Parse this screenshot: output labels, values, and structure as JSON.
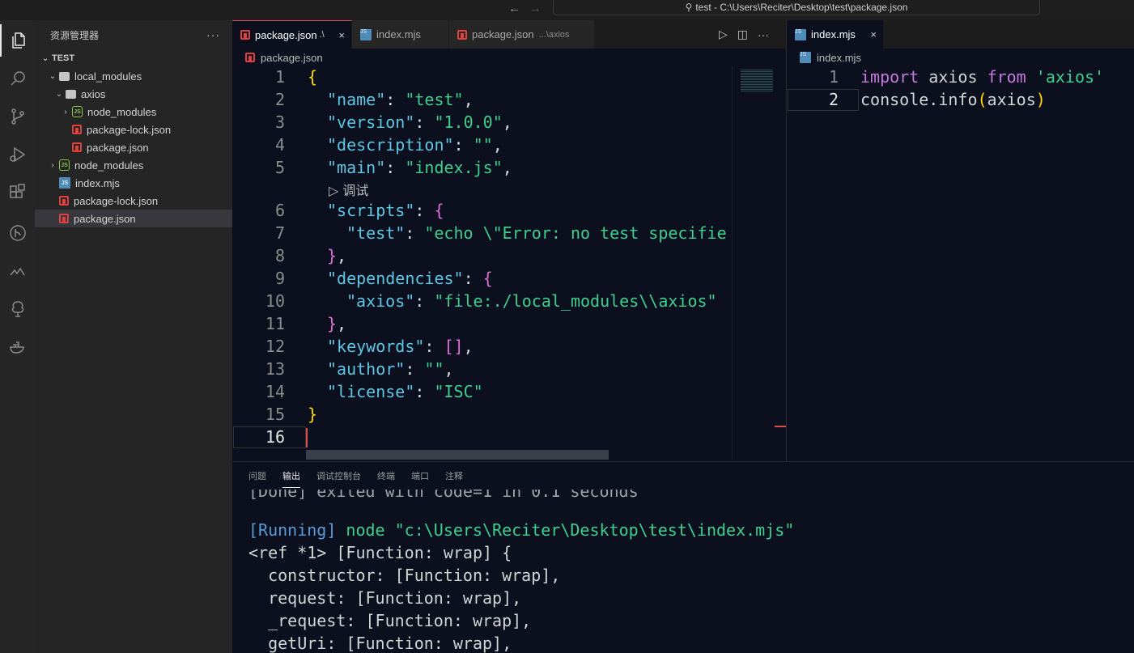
{
  "window": {
    "title": "test - C:\\Users\\Reciter\\Desktop\\test\\package.json"
  },
  "colors": {
    "background": "#0b0f1e",
    "tab_active_border": "#e04b4b",
    "json_key": "#5ec7e3",
    "json_string": "#3ecf8e",
    "keyword": "#c678dd"
  },
  "activity_bar": {
    "items": [
      "files-icon",
      "search-icon",
      "source-control-icon",
      "run-debug-icon",
      "extensions-icon",
      "git-graph-icon",
      "remote-icon",
      "tree-icon",
      "docker-icon"
    ]
  },
  "explorer": {
    "title": "资源管理器",
    "more": "···",
    "root": "TEST",
    "items": [
      {
        "label": "local_modules",
        "type": "folder",
        "open": true
      },
      {
        "label": "axios",
        "type": "folder",
        "open": true
      },
      {
        "label": "node_modules",
        "type": "node-folder",
        "open": false
      },
      {
        "label": "package-lock.json",
        "type": "json"
      },
      {
        "label": "package.json",
        "type": "json"
      },
      {
        "label": "node_modules",
        "type": "node-folder",
        "open": false
      },
      {
        "label": "index.mjs",
        "type": "js"
      },
      {
        "label": "package-lock.json",
        "type": "json"
      },
      {
        "label": "package.json",
        "type": "json",
        "selected": true
      }
    ]
  },
  "editor_left": {
    "tabs": [
      {
        "label": "package.json",
        "desc": ".\\",
        "close": "×"
      },
      {
        "label": "index.mjs",
        "desc": ""
      },
      {
        "label": "package.json",
        "desc": "...\\axios"
      }
    ],
    "breadcrumb": "package.json",
    "codelens": "▷ 调试",
    "line_numbers": [
      "1",
      "2",
      "3",
      "4",
      "5",
      "6",
      "7",
      "8",
      "9",
      "10",
      "11",
      "12",
      "13",
      "14",
      "15",
      "16"
    ],
    "lines": {
      "l1": "{",
      "l2k": "\"name\"",
      "l2v": "\"test\"",
      "l3k": "\"version\"",
      "l3v": "\"1.0.0\"",
      "l4k": "\"description\"",
      "l4v": "\"\"",
      "l5k": "\"main\"",
      "l5v": "\"index.js\"",
      "l6k": "\"scripts\"",
      "l6v": "{",
      "l7k": "\"test\"",
      "l7v": "\"echo \\\"Error: no test specifie",
      "l8": "}",
      "l9k": "\"dependencies\"",
      "l9v": "{",
      "l10k": "\"axios\"",
      "l10v": "\"file:./local_modules\\\\axios\"",
      "l11": "}",
      "l12k": "\"keywords\"",
      "l12v": "[]",
      "l13k": "\"author\"",
      "l13v": "\"\"",
      "l14k": "\"license\"",
      "l14v": "\"ISC\"",
      "l15": "}"
    }
  },
  "editor_right": {
    "tab": {
      "label": "index.mjs",
      "close": "×"
    },
    "breadcrumb": "index.mjs",
    "line_numbers": [
      "1",
      "2"
    ],
    "l1_import": "import",
    "l1_name": "axios",
    "l1_from": "from",
    "l1_module": "'axios'",
    "l2_call": "console.info",
    "l2_arg": "axios"
  },
  "panel": {
    "tabs": [
      "问题",
      "输出",
      "调试控制台",
      "终端",
      "端口",
      "注释"
    ],
    "active_tab": "输出",
    "done_line": "[Done] exited with code=1 in 0.1 seconds",
    "running_tag": "[Running]",
    "running_cmd": "node \"c:\\Users\\Reciter\\Desktop\\test\\index.mjs\"",
    "output": [
      "<ref *1> [Function: wrap] {",
      "  constructor: [Function: wrap],",
      "  request: [Function: wrap],",
      "  _request: [Function: wrap],",
      "  getUri: [Function: wrap],"
    ]
  }
}
